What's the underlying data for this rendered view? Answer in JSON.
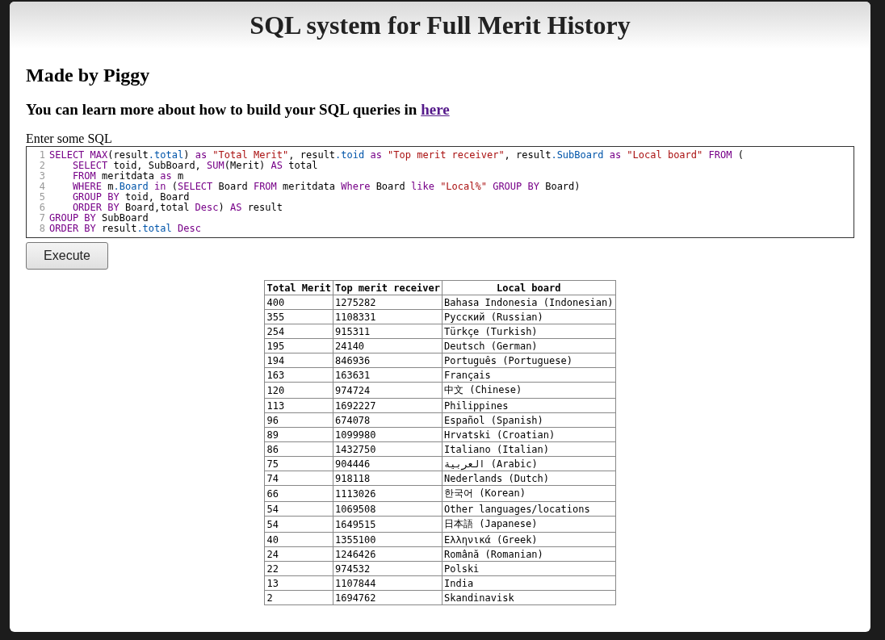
{
  "header": {
    "title": "SQL system for Full Merit History"
  },
  "author": "Made by Piggy",
  "intro": {
    "text": "You can learn more about how to build your SQL queries in",
    "link": "here"
  },
  "editor": {
    "label": "Enter some SQL",
    "lines": [
      {
        "num": "1",
        "indent": false,
        "tokens": [
          {
            "kind": "keyword",
            "text": "SELECT"
          },
          {
            "kind": "keyword",
            "text": " MAX"
          },
          {
            "kind": "plain",
            "text": "(result"
          },
          {
            "kind": "property",
            "text": ".total"
          },
          {
            "kind": "plain",
            "text": ")"
          },
          {
            "kind": "keyword",
            "text": " as"
          },
          {
            "kind": "string",
            "text": " \"Total Merit\""
          },
          {
            "kind": "plain",
            "text": ", result"
          },
          {
            "kind": "property",
            "text": ".toid"
          },
          {
            "kind": "keyword",
            "text": " as"
          },
          {
            "kind": "string",
            "text": " \"Top merit receiver\""
          },
          {
            "kind": "plain",
            "text": ", result"
          },
          {
            "kind": "property",
            "text": ".SubBoard"
          },
          {
            "kind": "keyword",
            "text": " as"
          },
          {
            "kind": "string",
            "text": " \"Local board\""
          },
          {
            "kind": "keyword",
            "text": " FROM"
          },
          {
            "kind": "plain",
            "text": " ("
          }
        ]
      },
      {
        "num": "2",
        "indent": true,
        "tokens": [
          {
            "kind": "keyword",
            "text": "SELECT"
          },
          {
            "kind": "plain",
            "text": " toid, SubBoard, "
          },
          {
            "kind": "keyword",
            "text": "SUM"
          },
          {
            "kind": "plain",
            "text": "(Merit) "
          },
          {
            "kind": "keyword",
            "text": "AS"
          },
          {
            "kind": "plain",
            "text": " total"
          }
        ]
      },
      {
        "num": "3",
        "indent": true,
        "tokens": [
          {
            "kind": "keyword",
            "text": "FROM"
          },
          {
            "kind": "plain",
            "text": " meritdata "
          },
          {
            "kind": "keyword",
            "text": "as"
          },
          {
            "kind": "plain",
            "text": " m"
          }
        ]
      },
      {
        "num": "4",
        "indent": true,
        "tokens": [
          {
            "kind": "keyword",
            "text": "WHERE"
          },
          {
            "kind": "plain",
            "text": " m"
          },
          {
            "kind": "property",
            "text": ".Board"
          },
          {
            "kind": "keyword",
            "text": " in"
          },
          {
            "kind": "plain",
            "text": " ("
          },
          {
            "kind": "keyword",
            "text": "SELECT"
          },
          {
            "kind": "plain",
            "text": " Board "
          },
          {
            "kind": "keyword",
            "text": "FROM"
          },
          {
            "kind": "plain",
            "text": " meritdata "
          },
          {
            "kind": "keyword",
            "text": "Where"
          },
          {
            "kind": "plain",
            "text": " Board "
          },
          {
            "kind": "keyword",
            "text": "like"
          },
          {
            "kind": "string",
            "text": " \"Local%\""
          },
          {
            "kind": "keyword",
            "text": " GROUP BY"
          },
          {
            "kind": "plain",
            "text": " Board)"
          }
        ]
      },
      {
        "num": "5",
        "indent": true,
        "tokens": [
          {
            "kind": "keyword",
            "text": "GROUP BY"
          },
          {
            "kind": "plain",
            "text": " toid, Board"
          }
        ]
      },
      {
        "num": "6",
        "indent": true,
        "tokens": [
          {
            "kind": "keyword",
            "text": "ORDER BY"
          },
          {
            "kind": "plain",
            "text": " Board,total "
          },
          {
            "kind": "keyword",
            "text": "Desc"
          },
          {
            "kind": "plain",
            "text": ") "
          },
          {
            "kind": "keyword",
            "text": "AS"
          },
          {
            "kind": "plain",
            "text": " result"
          }
        ]
      },
      {
        "num": "7",
        "indent": false,
        "tokens": [
          {
            "kind": "keyword",
            "text": "GROUP BY"
          },
          {
            "kind": "plain",
            "text": " SubBoard"
          }
        ]
      },
      {
        "num": "8",
        "indent": false,
        "tokens": [
          {
            "kind": "keyword",
            "text": "ORDER BY"
          },
          {
            "kind": "plain",
            "text": " result"
          },
          {
            "kind": "property",
            "text": ".total"
          },
          {
            "kind": "keyword",
            "text": " Desc"
          }
        ]
      }
    ]
  },
  "execute_button": "Execute",
  "table": {
    "columns": [
      "Total Merit",
      "Top merit receiver",
      "Local board"
    ],
    "rows": [
      [
        "400",
        "1275282",
        "Bahasa Indonesia (Indonesian)"
      ],
      [
        "355",
        "1108331",
        "Русский (Russian)"
      ],
      [
        "254",
        "915311",
        "Türkçe (Turkish)"
      ],
      [
        "195",
        "24140",
        "Deutsch (German)"
      ],
      [
        "194",
        "846936",
        "Português (Portuguese)"
      ],
      [
        "163",
        "163631",
        "Français"
      ],
      [
        "120",
        "974724",
        "中文 (Chinese)"
      ],
      [
        "113",
        "1692227",
        "Philippines"
      ],
      [
        "96",
        "674078",
        "Español (Spanish)"
      ],
      [
        "89",
        "1099980",
        "Hrvatski (Croatian)"
      ],
      [
        "86",
        "1432750",
        "Italiano (Italian)"
      ],
      [
        "75",
        "904446",
        "العربية (Arabic)"
      ],
      [
        "74",
        "918118",
        "Nederlands (Dutch)"
      ],
      [
        "66",
        "1113026",
        "한국어 (Korean)"
      ],
      [
        "54",
        "1069508",
        "Other languages/locations"
      ],
      [
        "54",
        "1649515",
        "日本語 (Japanese)"
      ],
      [
        "40",
        "1355100",
        "Ελληνικά (Greek)"
      ],
      [
        "24",
        "1246426",
        "Română (Romanian)"
      ],
      [
        "22",
        "974532",
        "Polski"
      ],
      [
        "13",
        "1107844",
        "India"
      ],
      [
        "2",
        "1694762",
        "Skandinavisk"
      ]
    ]
  }
}
